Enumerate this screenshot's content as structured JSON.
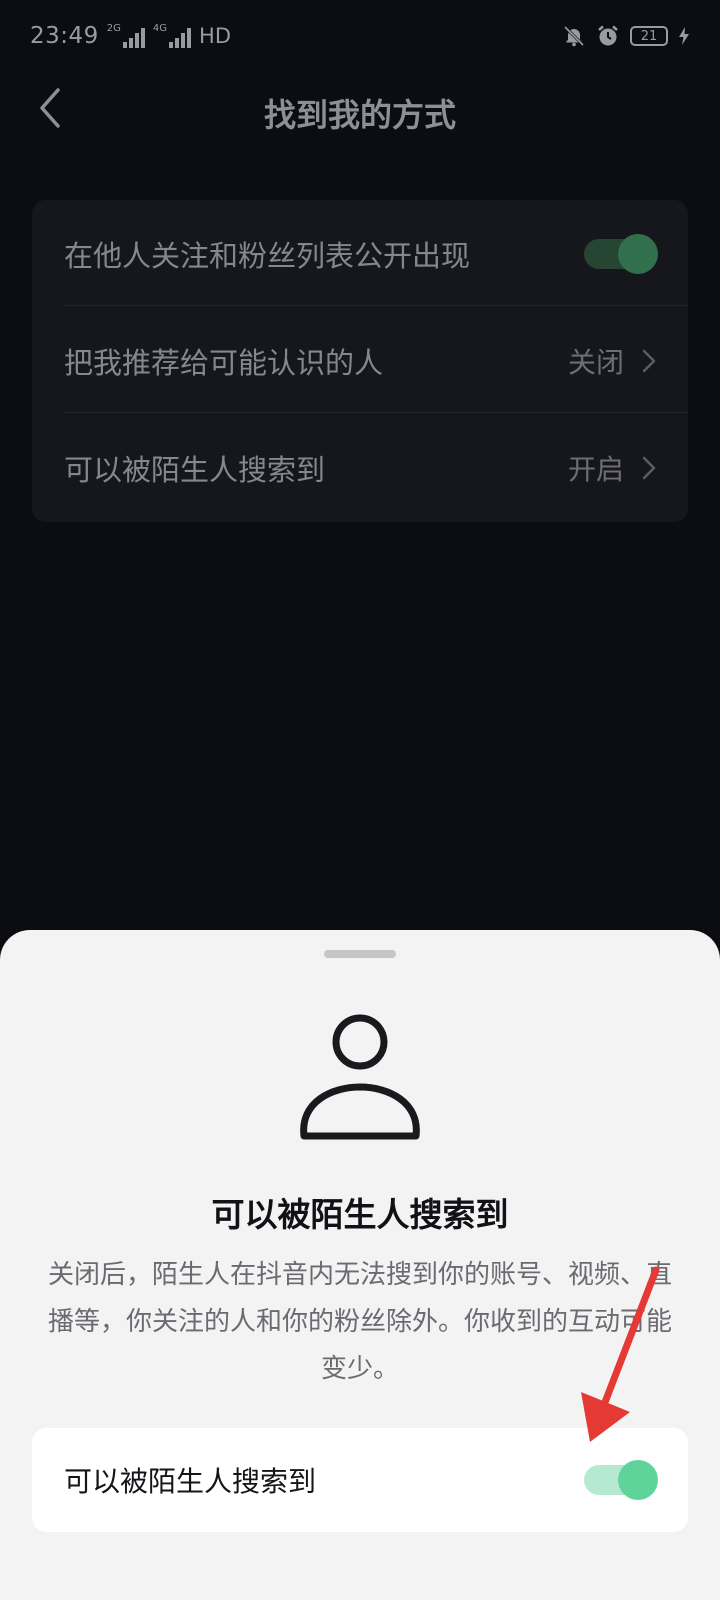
{
  "status_bar": {
    "time": "23:49",
    "network_1": "2G",
    "network_2": "4G",
    "hd_label": "HD",
    "battery_level": "21",
    "icons": [
      "mute-bell-icon",
      "alarm-icon",
      "battery-icon",
      "charging-icon"
    ]
  },
  "header": {
    "title": "找到我的方式",
    "back_icon": "back-arrow-icon"
  },
  "settings": {
    "rows": [
      {
        "label": "在他人关注和粉丝列表公开出现",
        "control": "toggle",
        "on": true
      },
      {
        "label": "把我推荐给可能认识的人",
        "value": "关闭",
        "control": "chevron"
      },
      {
        "label": "可以被陌生人搜索到",
        "value": "开启",
        "control": "chevron"
      }
    ]
  },
  "sheet": {
    "icon": "person-icon",
    "title": "可以被陌生人搜索到",
    "description": "关闭后，陌生人在抖音内无法搜到你的账号、视频、直播等，你关注的人和你的粉丝除外。你收到的互动可能变少。",
    "option": {
      "label": "可以被陌生人搜索到",
      "on": true
    }
  },
  "annotation": {
    "color": "#e53935",
    "icon": "red-arrow-annotation"
  },
  "colors": {
    "background": "#0c0d12",
    "card": "#16171c",
    "sheet": "#f3f3f3",
    "toggle_accent": "#5fd49a"
  }
}
